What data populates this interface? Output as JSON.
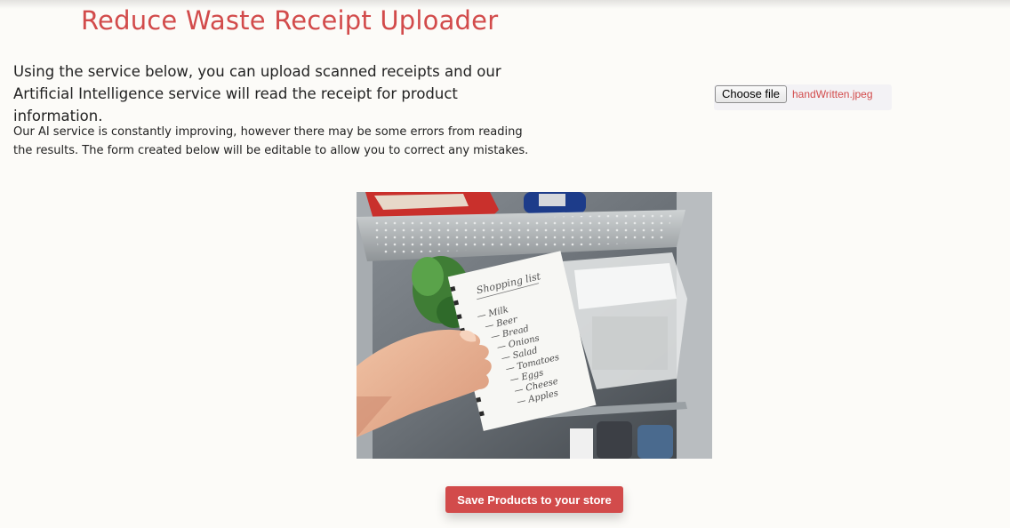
{
  "page": {
    "title": "Reduce Waste Receipt Uploader",
    "intro": "Using the service below, you can upload scanned receipts and our Artificial Intelligence service will read the receipt for product information.",
    "note": "Our AI service is constantly improving, however there may be some errors from reading the results. The form created below will be editable to allow you to correct any mistakes."
  },
  "upload": {
    "button_label": "Choose file",
    "file_name": "handWritten.jpeg"
  },
  "image": {
    "list_title": "Shopping list",
    "items": [
      "Milk",
      "Beer",
      "Bread",
      "Onions",
      "Salad",
      "Tomatoes",
      "Eggs",
      "Cheese",
      "Apples"
    ]
  },
  "actions": {
    "save_label": "Save Products to your store"
  },
  "colors": {
    "accent": "#d24b4b",
    "background": "#fcfbf8"
  }
}
